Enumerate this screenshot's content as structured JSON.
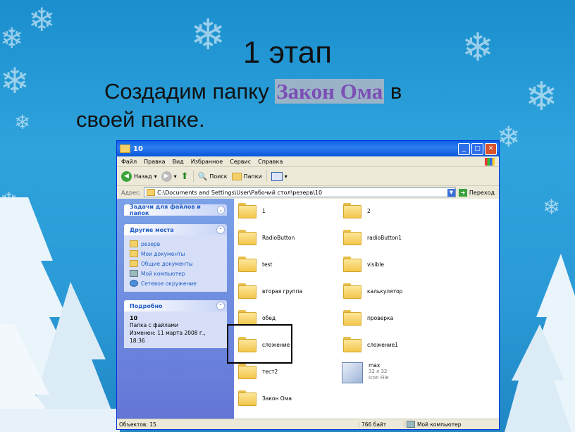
{
  "slide": {
    "title": "1 этап",
    "text_before": "Создадим папку ",
    "text_highlight": "Закон Ома",
    "text_after_1": " в",
    "text_line2": "своей папке."
  },
  "window": {
    "title": "10",
    "menu": [
      "Файл",
      "Правка",
      "Вид",
      "Избранное",
      "Сервис",
      "Справка"
    ],
    "toolbar": {
      "back": "Назад",
      "search": "Поиск",
      "folders": "Папки"
    },
    "address": {
      "label": "Адрес:",
      "value": "C:\\Documents and Settings\\User\\Рабочий стол\\резерв\\10",
      "go": "Переход"
    },
    "sidebar": {
      "tasks_title": "Задачи для файлов и папок",
      "places_title": "Другие места",
      "places": [
        "резерв",
        "Мои документы",
        "Общие документы",
        "Мой компьютер",
        "Сетевое окружение"
      ],
      "details_title": "Подробно",
      "details_name": "10",
      "details_type": "Папка с файлами",
      "details_modified": "Изменен: 11 марта 2008 г., 18:36"
    },
    "folders_left": [
      "1",
      "RadioButton",
      "test",
      "вторая группа",
      "обед",
      "сложение",
      "тест2",
      "Закон Ома"
    ],
    "folders_right": [
      "2",
      "radioButton1",
      "visible",
      "калькулятор",
      "проверка",
      "сложение1"
    ],
    "file": {
      "name": "max",
      "size": "32 x 32",
      "type": "Icon File"
    },
    "status": {
      "objects": "Объектов: 15",
      "size": "766 байт",
      "location": "Мой компьютер"
    }
  }
}
